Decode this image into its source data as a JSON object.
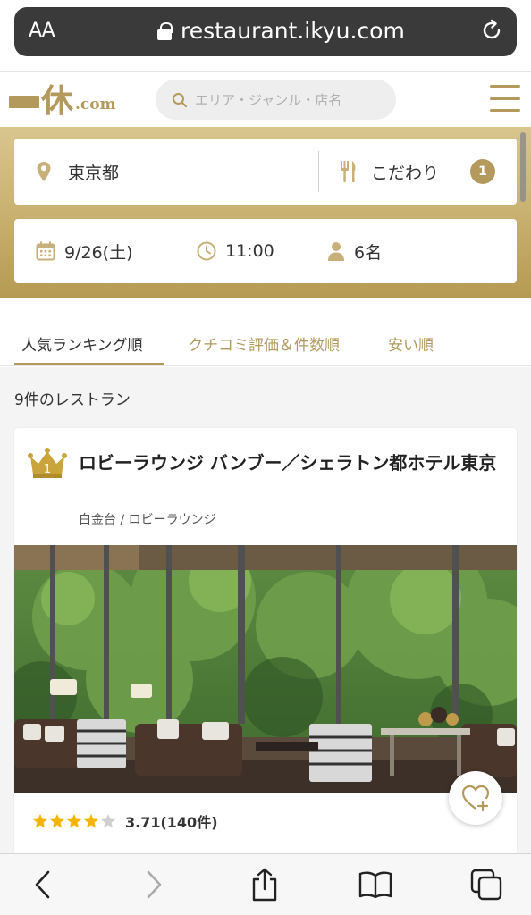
{
  "browser": {
    "text_size_label": "AA",
    "url": "restaurant.ikyu.com"
  },
  "header": {
    "logo_mark": "休",
    "logo_domain": ".com",
    "search_placeholder": "エリア・ジャンル・店名"
  },
  "filters": {
    "location": "東京都",
    "kodawari_label": "こだわり",
    "kodawari_count": "1",
    "date": "9/26(土)",
    "time": "11:00",
    "party_size": "6名"
  },
  "tabs": [
    {
      "label": "人気ランキング順",
      "active": true
    },
    {
      "label": "クチコミ評価＆件数順",
      "active": false
    },
    {
      "label": "安い順",
      "active": false
    }
  ],
  "results": {
    "count_text": "9件のレストラン",
    "items": [
      {
        "rank": "1",
        "name": "ロビーラウンジ バンブー／シェラトン都ホテル東京",
        "area_genre": "白金台 / ロビーラウンジ",
        "rating": 3.71,
        "rating_text": "3.71(140件)",
        "stars_filled": 4
      }
    ]
  },
  "colors": {
    "accent": "#b39a5c",
    "star": "#f5b400"
  },
  "icons": [
    "lock-icon",
    "reload-icon",
    "search-icon",
    "hamburger-icon",
    "location-pin-icon",
    "utensils-icon",
    "calendar-icon",
    "clock-icon",
    "person-icon",
    "crown-icon",
    "heart-plus-icon",
    "back-icon",
    "forward-icon",
    "share-icon",
    "bookmarks-icon",
    "tabs-icon"
  ]
}
